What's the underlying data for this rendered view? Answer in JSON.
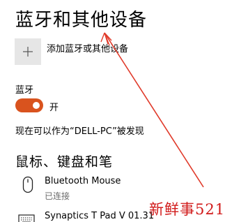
{
  "page": {
    "title": "蓝牙和其他设备"
  },
  "add_device": {
    "label": "添加蓝牙或其他设备",
    "icon": "plus-icon"
  },
  "bluetooth": {
    "label": "蓝牙",
    "toggle_state": "开",
    "toggle_on": true,
    "discoverable_text": "现在可以作为“DELL-PC”被发现"
  },
  "section": {
    "title": "鼠标、键盘和笔"
  },
  "devices": [
    {
      "name": "Bluetooth Mouse",
      "status": "已连接",
      "icon": "mouse-icon"
    },
    {
      "name": "Synaptics T Pad V 01.31",
      "icon": "keyboard-icon"
    }
  ],
  "annotation": {
    "color": "#e03a2a"
  },
  "watermark": {
    "text": "新鲜事521"
  },
  "colors": {
    "accent": "#d9531e",
    "annotation": "#e03a2a",
    "watermark": "#d11a1a",
    "secondary_text": "#6b6b6b",
    "tile_bg": "#e6e6e6"
  }
}
